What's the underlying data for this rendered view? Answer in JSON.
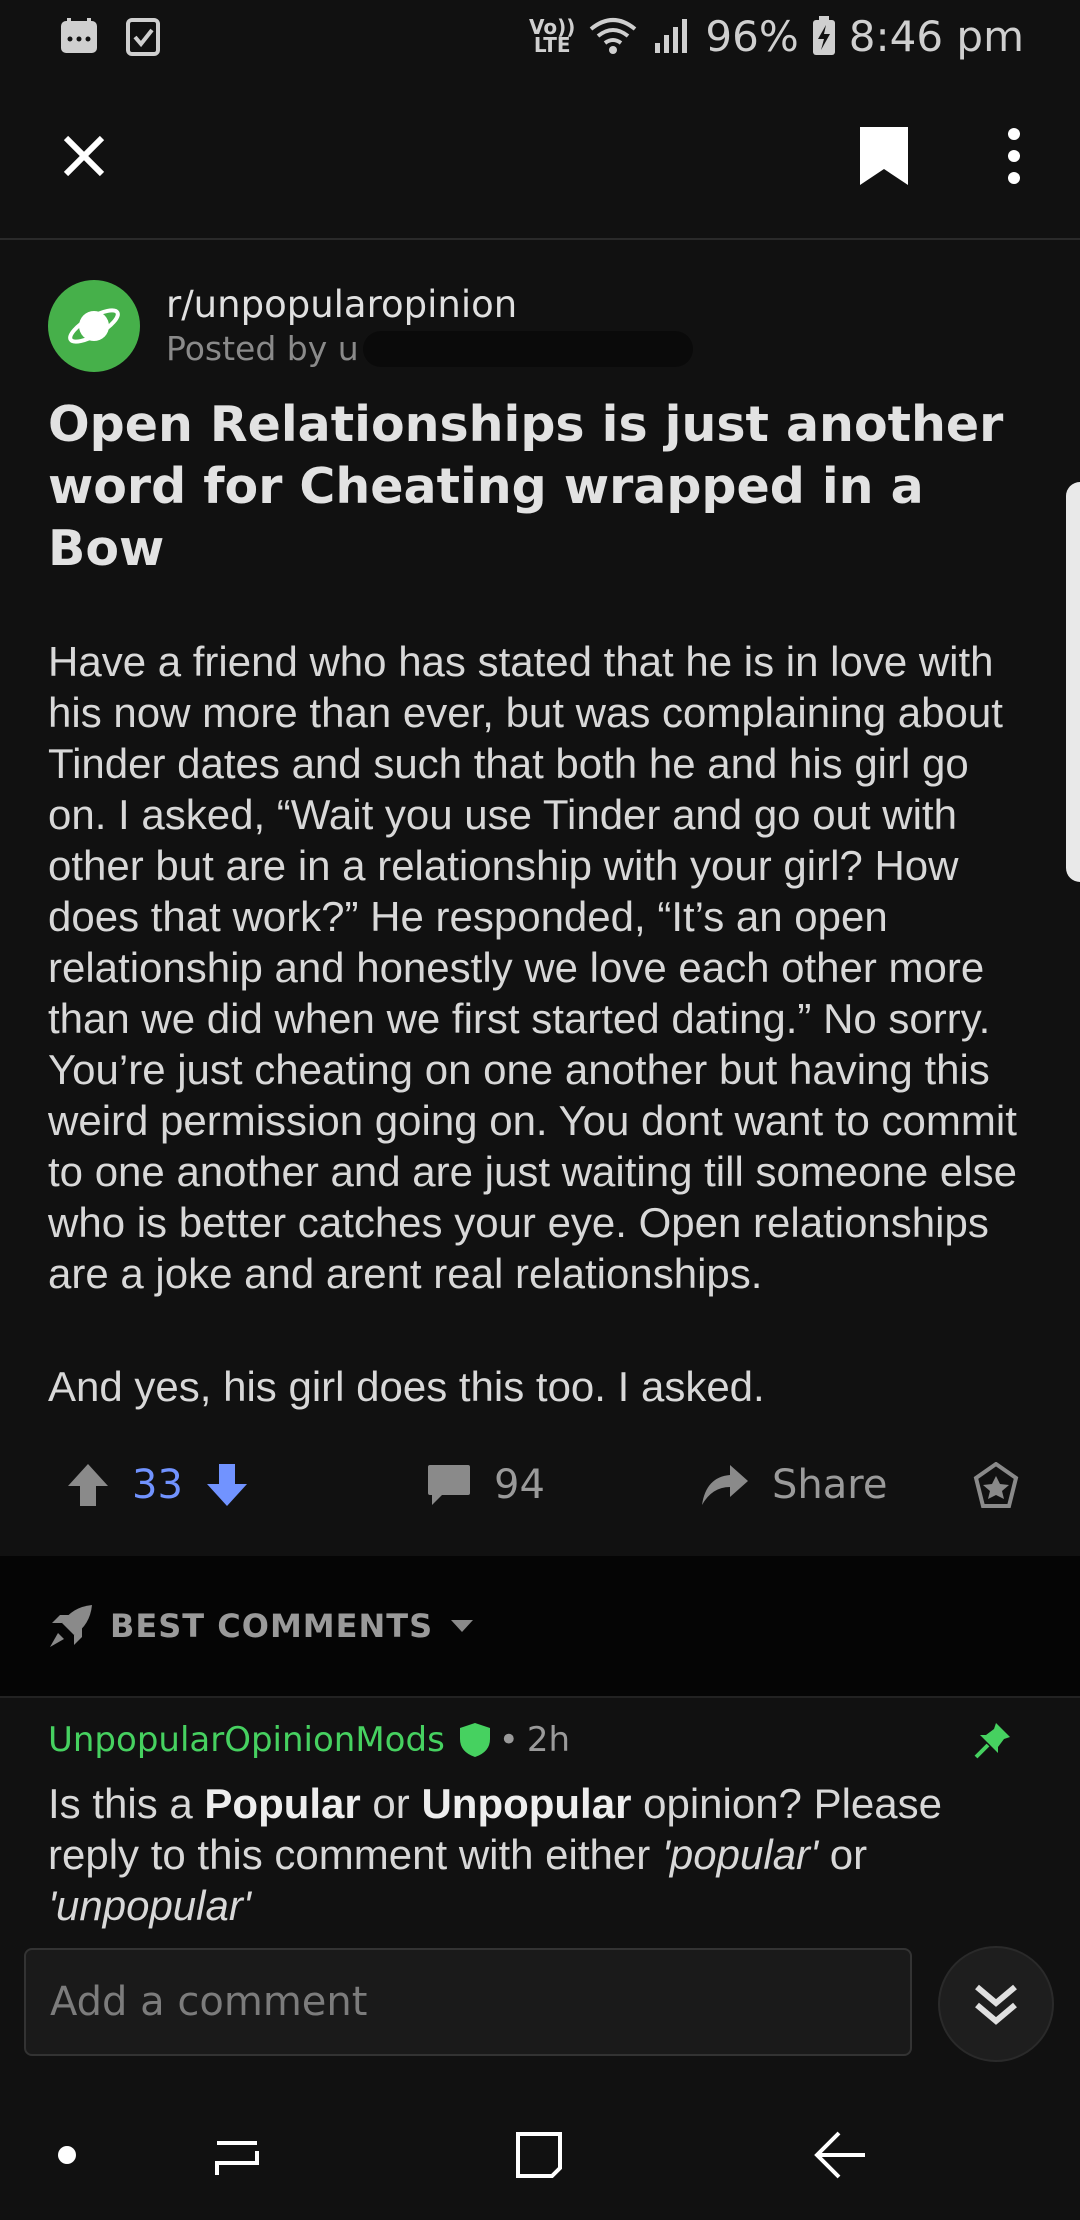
{
  "status_bar": {
    "volte_top": "Vo))",
    "volte_bottom": "LTE",
    "battery": "96%",
    "time": "8:46 pm"
  },
  "post": {
    "subreddit": "r/unpopularopinion",
    "posted_by": "Posted by u",
    "title": "Open Relationships is just another word for Cheating wrapped in a Bow",
    "body": [
      "Have a friend who has stated that he is in love with his now more than ever, but was complaining about Tinder dates and such that both he and his girl go on. I asked, “Wait you use Tinder and go out with other but are in a relationship with your girl? How does that work?” He responded, “It’s an open relationship and honestly we love each other more than we did when we first started dating.” No sorry. You’re just cheating on one another but having this weird permission going on. You dont want to commit to one another and are just waiting till someone else who is better catches your eye. Open relationships are a joke and arent real relationships.",
      "And yes, his girl does this too. I asked."
    ],
    "score": "33",
    "comment_count": "94",
    "share_label": "Share"
  },
  "sort": {
    "label": "BEST COMMENTS"
  },
  "comment": {
    "author": "UnpopularOpinionMods",
    "separator": "•",
    "age": "2h",
    "body_prefix": "Is this a ",
    "bold_1": "Popular",
    "body_mid": " or ",
    "bold_2": "Unpopular",
    "body_suffix": " opinion? Please reply to this comment with either ",
    "italic_1": "'popular'",
    "body_or": " or ",
    "italic_2": "'unpopular'"
  },
  "composer": {
    "placeholder": "Add a comment"
  },
  "colors": {
    "background": "#111111",
    "upvote_active": "#7193ff",
    "mod_green": "#46d160",
    "subreddit_icon": "#46b04a"
  },
  "icons": {
    "close": "close-icon",
    "bookmark": "bookmark-icon",
    "overflow": "more-vertical-icon",
    "upvote": "arrow-up-icon",
    "downvote": "arrow-down-icon",
    "comment": "comment-bubble-icon",
    "share": "share-arrow-icon",
    "award": "award-icon",
    "sort": "rocket-icon",
    "pin": "pin-icon",
    "jump": "double-chevron-down-icon"
  }
}
